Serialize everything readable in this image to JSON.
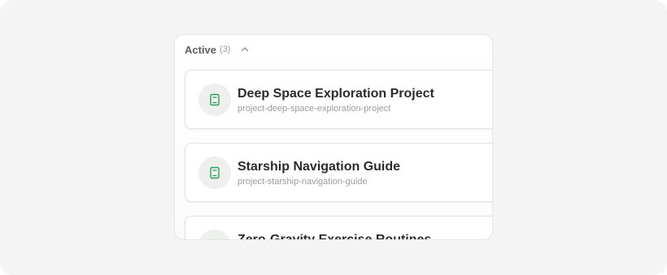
{
  "section": {
    "title": "Active",
    "count": "(3)",
    "toggle_icon": "chevron-up-icon"
  },
  "colors": {
    "icon_accent": "#2f9e58",
    "icon_bg": "#edf0ed",
    "background": "#f4f4f4"
  },
  "projects": [
    {
      "title": "Deep Space Exploration Project",
      "slug": "project-deep-space-exploration-project",
      "icon": "notebook-icon"
    },
    {
      "title": "Starship Navigation Guide",
      "slug": "project-starship-navigation-guide",
      "icon": "notebook-icon"
    },
    {
      "title": "Zero-Gravity Exercise Routines",
      "slug": "",
      "icon": "notebook-icon"
    }
  ]
}
